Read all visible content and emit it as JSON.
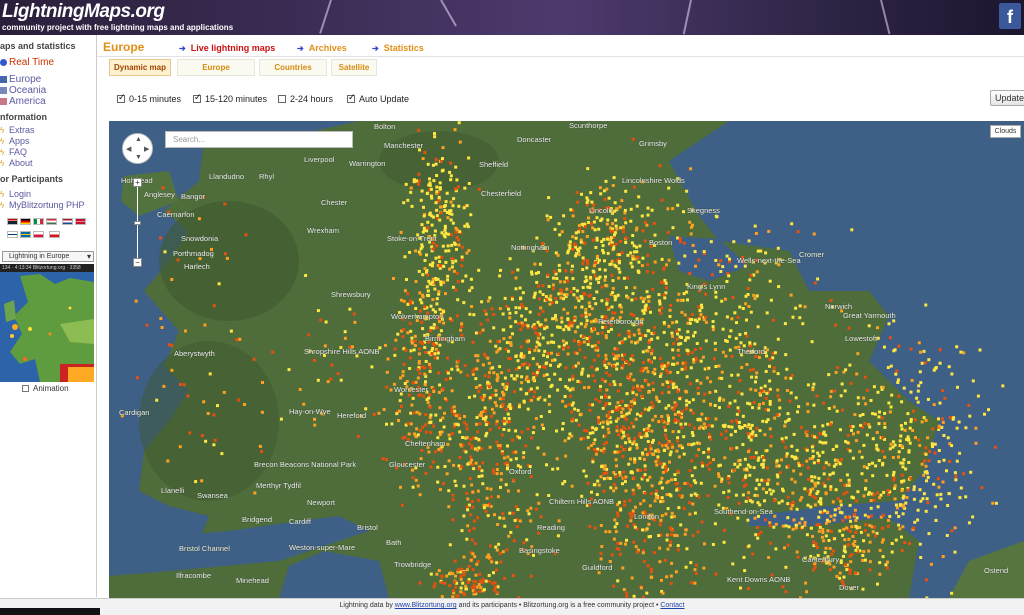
{
  "header": {
    "logo_text": "LightningMaps.org",
    "tagline": "community project with free lightning maps and applications",
    "facebook_glyph": "f"
  },
  "sidebar": {
    "maps_heading": "aps and statistics",
    "realtime_label": "Real Time",
    "regions": [
      {
        "label": "Europe",
        "color": "#5a5aa0"
      },
      {
        "label": "Oceania",
        "color": "#5a5aa0"
      },
      {
        "label": "America",
        "color": "#5a5aa0"
      }
    ],
    "info_heading": "nformation",
    "info_links": [
      "Extras",
      "Apps",
      "FAQ",
      "About"
    ],
    "participants_heading": "or Participants",
    "participant_links": [
      "Login",
      "MyBlitzortung PHP"
    ],
    "mini_map": {
      "select_value": "Lightning in Europe",
      "topbar_text": "134 · 4:13:34 Blitzortung.org · 3358",
      "animation_label": "Animation"
    }
  },
  "topnav": {
    "region_title": "Europe",
    "links": [
      {
        "label": "Live lightning maps",
        "color": "#cc1111"
      },
      {
        "label": "Archives",
        "color": "#e0901a"
      },
      {
        "label": "Statistics",
        "color": "#e0901a"
      }
    ]
  },
  "subtabs": [
    {
      "label": "Dynamic map",
      "active": true
    },
    {
      "label": "Europe",
      "active": false
    },
    {
      "label": "Countries",
      "active": false
    },
    {
      "label": "Satellite",
      "active": false
    }
  ],
  "filters": {
    "options": [
      {
        "label": "0-15 minutes",
        "checked": true
      },
      {
        "label": "15-120 minutes",
        "checked": true
      },
      {
        "label": "2-24 hours",
        "checked": false
      },
      {
        "label": "Auto Update",
        "checked": true
      }
    ],
    "update_button": "Update"
  },
  "map": {
    "search_placeholder": "Search...",
    "clouds_button": "Clouds",
    "zoom_in": "+",
    "zoom_out": "−",
    "place_labels": [
      "Bolton",
      "Scunthorpe",
      "Manchester",
      "Doncaster",
      "Grimsby",
      "Liverpool",
      "Warrington",
      "Sheffield",
      "Holyhead",
      "Llandudno",
      "Rhyl",
      "Chesterfield",
      "Lincolnshire Wolds",
      "Anglesey",
      "Bangor",
      "Lincoln",
      "Skegness",
      "Caernarfon",
      "Chester",
      "Nottingham",
      "Snowdonia",
      "Wrexham",
      "Stoke-on-Trent",
      "Boston",
      "Wells-next-the-Sea",
      "Cromer",
      "Porthmadog",
      "Harlech",
      "King's Lynn",
      "Shrewsbury",
      "Norwich",
      "Great Yarmouth",
      "Wolverhampton",
      "Birmingham",
      "Peterborough",
      "Lowestoft",
      "Aberystwyth",
      "Shropshire Hills AONB",
      "Thetford",
      "Cardigan",
      "Hay-on-Wye",
      "Hereford",
      "Worcester",
      "Cheltenham",
      "Gloucester",
      "Brecon Beacons National Park",
      "Oxford",
      "Merthyr Tydfil",
      "Swansea",
      "Newport",
      "Llanelli",
      "Cardiff",
      "Bristol",
      "Reading",
      "London",
      "Bridgend",
      "Weston-super-Mare",
      "Bath",
      "Basingstoke",
      "Guildford",
      "Canterbury",
      "Dover",
      "Bristol Channel",
      "Trowbridge",
      "Ilfracombe",
      "Minehead",
      "Ostend",
      "Southend-on-Sea",
      "Kent Downs AONB",
      "Chiltern Hills AONB"
    ]
  },
  "footer": {
    "prefix": "Lightning data by ",
    "link_text": "www.Blitzortung.org",
    "middle": " and its participants • Blitzortung.org is a free community project • ",
    "contact": "Contact"
  },
  "colors": {
    "accent_orange": "#e0901a",
    "live_red": "#cc1111",
    "strike_recent": "#ffe640",
    "strike_mid": "#ffa020",
    "strike_old": "#e85010",
    "sea": "#3e5f86",
    "land": "#4c6b3a"
  }
}
